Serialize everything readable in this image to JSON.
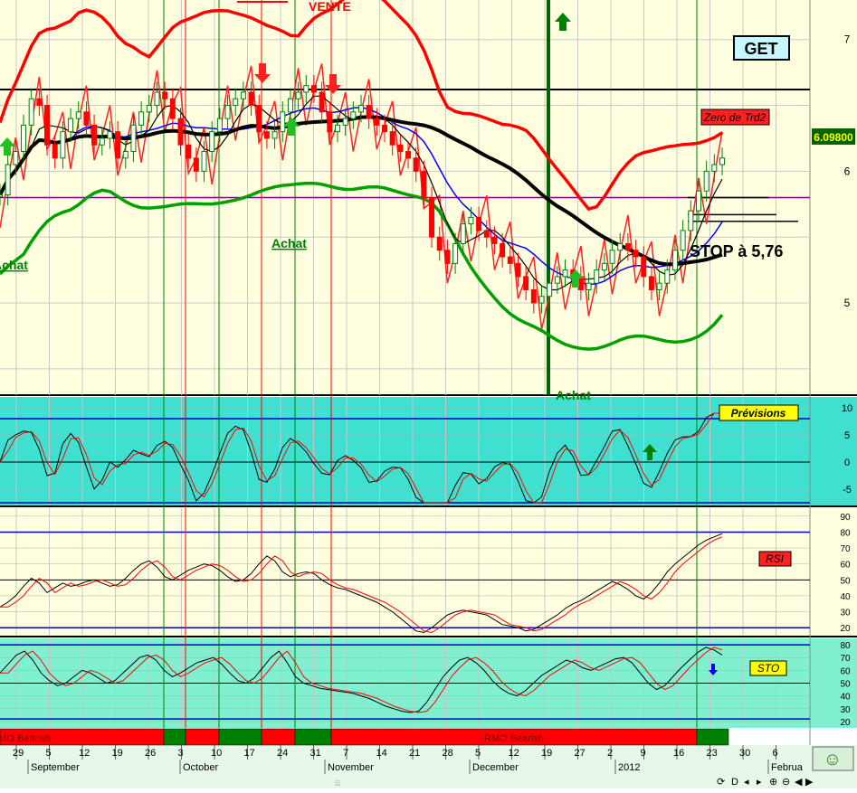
{
  "ticker": "GET",
  "price_tag": "6.09800",
  "labels": {
    "vente": "VENTE",
    "achat_left": "Achat",
    "achat_mid": "Achat",
    "achat_bottom": "Achat",
    "stop": "STOP à 5,76",
    "zero_trd": "Zero de Trd2",
    "previsions": "Prévisions",
    "rsi": "RSI",
    "sto": "STO",
    "rmo_bearish_left": "MO Bearish",
    "rmo_bearish_mid": "RMO Bearish"
  },
  "colors": {
    "main_bg": "#ffffe0",
    "osc_bg": "#40e0d0",
    "rsi_bg": "#ffffe0",
    "sto_bg": "#80f0d0",
    "bull": "#008000",
    "bear": "#ff0000",
    "band": "#ff0000",
    "envelope": "#00a000",
    "ma_blue": "#0000ff",
    "ma_black": "#000000"
  },
  "chart_data": [
    {
      "type": "line",
      "name": "price",
      "ylim": [
        4.3,
        7.3
      ],
      "y_ticks": [
        5,
        6,
        7
      ],
      "x_tick_labels": [
        "29",
        "5",
        "12",
        "19",
        "26",
        "3",
        "10",
        "17",
        "24",
        "31",
        "7",
        "14",
        "21",
        "28",
        "5",
        "12",
        "19",
        "27",
        "2",
        "9",
        "16",
        "23",
        "30",
        "6"
      ],
      "month_labels": [
        "September",
        "October",
        "November",
        "December",
        "2012",
        "Februa"
      ],
      "horizontal_lines": [
        6.62,
        5.8
      ],
      "close": [
        5.82,
        6.05,
        6.15,
        6.35,
        6.55,
        6.5,
        6.2,
        6.1,
        6.3,
        6.4,
        6.45,
        6.35,
        6.2,
        6.25,
        6.3,
        6.1,
        6.15,
        6.35,
        6.45,
        6.5,
        6.6,
        6.55,
        6.4,
        6.2,
        6.1,
        6.0,
        6.15,
        6.3,
        6.4,
        6.5,
        6.55,
        6.6,
        6.5,
        6.3,
        6.25,
        6.3,
        6.45,
        6.55,
        6.6,
        6.65,
        6.6,
        6.45,
        6.3,
        6.35,
        6.4,
        6.45,
        6.5,
        6.4,
        6.35,
        6.3,
        6.2,
        6.15,
        6.1,
        6.0,
        5.8,
        5.5,
        5.4,
        5.3,
        5.45,
        5.6,
        5.65,
        5.55,
        5.5,
        5.45,
        5.35,
        5.3,
        5.2,
        5.1,
        5.0,
        5.05,
        5.15,
        5.2,
        5.25,
        5.2,
        5.1,
        5.15,
        5.25,
        5.3,
        5.4,
        5.45,
        5.4,
        5.35,
        5.2,
        5.1,
        5.15,
        5.25,
        5.4,
        5.55,
        5.7,
        5.85,
        6.0,
        6.05,
        6.1
      ]
    },
    {
      "type": "line",
      "name": "Prévisions",
      "ylim": [
        -8,
        12
      ],
      "y_ticks": [
        -5,
        0,
        5,
        10
      ],
      "bands": [
        8,
        -7.5
      ]
    },
    {
      "type": "line",
      "name": "RSI",
      "ylim": [
        15,
        95
      ],
      "y_ticks": [
        20,
        30,
        40,
        50,
        60,
        70,
        80,
        90
      ],
      "bands": [
        80,
        20,
        50
      ],
      "values": [
        33,
        36,
        40,
        46,
        51,
        48,
        42,
        45,
        48,
        46,
        47,
        49,
        50,
        48,
        46,
        47,
        51,
        56,
        60,
        62,
        58,
        52,
        50,
        53,
        56,
        58,
        60,
        59,
        56,
        52,
        49,
        50,
        54,
        60,
        65,
        62,
        55,
        52,
        54,
        55,
        54,
        50,
        47,
        45,
        44,
        42,
        40,
        38,
        36,
        33,
        30,
        26,
        22,
        18,
        17,
        20,
        24,
        28,
        30,
        31,
        30,
        29,
        28,
        25,
        22,
        21,
        20,
        18,
        19,
        22,
        25,
        28,
        32,
        35,
        37,
        40,
        43,
        46,
        49,
        47,
        44,
        40,
        38,
        42,
        48,
        55,
        60,
        64,
        68,
        72,
        75,
        77,
        79
      ]
    },
    {
      "type": "line",
      "name": "STO",
      "ylim": [
        15,
        85
      ],
      "y_ticks": [
        20,
        30,
        40,
        50,
        60,
        70,
        80
      ],
      "bands": [
        80,
        22,
        50
      ],
      "values": [
        58,
        65,
        72,
        75,
        68,
        58,
        52,
        48,
        50,
        55,
        60,
        58,
        54,
        50,
        52,
        58,
        64,
        70,
        72,
        68,
        60,
        55,
        58,
        62,
        66,
        68,
        70,
        65,
        58,
        52,
        50,
        54,
        62,
        70,
        75,
        66,
        55,
        50,
        48,
        46,
        45,
        44,
        43,
        42,
        40,
        38,
        35,
        32,
        30,
        28,
        27,
        28,
        35,
        45,
        55,
        62,
        68,
        70,
        66,
        60,
        52,
        46,
        42,
        40,
        44,
        50,
        56,
        60,
        64,
        68,
        66,
        62,
        60,
        63,
        66,
        69,
        70,
        66,
        58,
        50,
        45,
        48,
        55,
        62,
        68,
        74,
        78,
        76,
        72
      ]
    }
  ],
  "rmo_segments": [
    {
      "state": "bear",
      "label": "MO Bearish"
    },
    {
      "state": "bull",
      "label": ""
    },
    {
      "state": "bear",
      "label": ""
    },
    {
      "state": "bull",
      "label": ""
    },
    {
      "state": "bear",
      "label": ""
    },
    {
      "state": "bull",
      "label": ""
    },
    {
      "state": "bear",
      "label": "RMO Bearish"
    },
    {
      "state": "bull",
      "label": ""
    }
  ]
}
